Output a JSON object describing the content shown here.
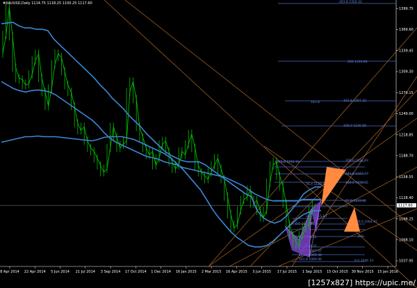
{
  "header": {
    "symbol_line": "#XAUUSD,Daily  1114.75 1118.25 1100.25 1117.60"
  },
  "watermark": "[1257x827] https://upic.me/",
  "colors": {
    "background": "#000000",
    "candle": "#00c000",
    "bands": "#3a8ad8",
    "fib_lines": "#4a6ac8",
    "trend_lines": "#b06a2a",
    "pattern_fill": "#7a3ec8",
    "arrow": "#ff8a40",
    "price_label_bg": "#ffffff"
  },
  "chart_data": {
    "type": "line",
    "title": "",
    "xlabel": "",
    "ylabel": "",
    "x_ticks": [
      "8 Apr 2014",
      "22 Apr 2014",
      "5 Jun 2014",
      "21 Jul 2014",
      "3 Sep 2014",
      "17 Oct 2014",
      "1 Dec 2014",
      "16 Jan 2015",
      "2 Mar 2015",
      "16 Apr 2015",
      "3 Jun 2015",
      "17 Jul 2015",
      "1 Sep 2015",
      "15 Oct 2015",
      "30 Nov 2015",
      "15 Jan 2016"
    ],
    "y_ticks": [
      1399.75,
      1369.6,
      1339.45,
      1309.3,
      1279.15,
      1249.0,
      1218.85,
      1188.7,
      1158.55,
      1128.4,
      1098.25,
      1068.1,
      1037.95
    ],
    "ylim": [
      1030,
      1410
    ],
    "current_price": "1117.60",
    "grid": false,
    "series": [
      {
        "values": [
          1335,
          1362,
          1402,
          1360,
          1315,
          1300,
          1298,
          1290,
          1292,
          1305,
          1325,
          1335,
          1300,
          1280,
          1260,
          1285,
          1320,
          1335,
          1330,
          1310,
          1290,
          1280,
          1260,
          1235,
          1225,
          1230,
          1210,
          1200,
          1195,
          1185,
          1175,
          1165,
          1170,
          1200,
          1230,
          1215,
          1200,
          1205,
          1210,
          1280,
          1295,
          1270,
          1230,
          1215,
          1200,
          1190,
          1195,
          1175,
          1185,
          1205,
          1210,
          1195,
          1180,
          1170,
          1175,
          1195,
          1190,
          1205,
          1220,
          1200,
          1175,
          1165,
          1160,
          1155,
          1165,
          1175,
          1185,
          1170,
          1155,
          1130,
          1105,
          1085,
          1090,
          1110,
          1125,
          1130,
          1140,
          1120,
          1125,
          1110,
          1100,
          1110,
          1150,
          1175,
          1180,
          1160,
          1145,
          1120,
          1090,
          1075,
          1065,
          1060,
          1075,
          1085,
          1090,
          1110,
          1120
        ]
      },
      {
        "values": [
          1378,
          1379,
          1380,
          1375,
          1372,
          1372,
          1370,
          1370,
          1368,
          1356,
          1348,
          1340,
          1332,
          1324,
          1316,
          1308,
          1300,
          1290,
          1282,
          1272,
          1264,
          1256,
          1246,
          1238,
          1230,
          1220,
          1212,
          1204,
          1196,
          1190,
          1186,
          1182,
          1180,
          1180,
          1180,
          1176,
          1170,
          1164,
          1158,
          1152,
          1146,
          1140,
          1134,
          1130,
          1110,
          1100,
          1095,
          1092,
          1095,
          1102,
          1112,
          1122,
          1134,
          1140,
          1144,
          1144
        ]
      },
      {
        "values": [
          1295,
          1290,
          1285,
          1282,
          1280,
          1282,
          1283,
          1282,
          1280,
          1276,
          1270,
          1264,
          1258,
          1252,
          1246,
          1240,
          1232,
          1222,
          1214,
          1208,
          1204,
          1200,
          1196,
          1192,
          1188,
          1186,
          1184,
          1180,
          1178,
          1176,
          1172,
          1170,
          1168,
          1166,
          1164,
          1162,
          1160,
          1158,
          1154,
          1150,
          1146,
          1140,
          1134,
          1130,
          1126,
          1124,
          1124,
          1124,
          1124,
          1124,
          1126,
          1126,
          1126,
          1126
        ]
      },
      {
        "values": [
          1208,
          1210,
          1212,
          1214,
          1216,
          1216,
          1217,
          1216,
          1216,
          1216,
          1215,
          1214,
          1213,
          1212,
          1211,
          1210,
          1212,
          1215,
          1216,
          1216,
          1216,
          1214,
          1212,
          1208,
          1204,
          1200,
          1196,
          1192,
          1186,
          1178,
          1170,
          1160,
          1150,
          1140,
          1126,
          1112,
          1100,
          1090,
          1080,
          1072,
          1066,
          1060,
          1058,
          1058,
          1060,
          1066,
          1074,
          1082,
          1090,
          1098,
          1104,
          1108,
          1110,
          1110
        ]
      }
    ],
    "fib_labels_upper": [
      "261.8 1354.22",
      "200 1319.80",
      "161.8 1267.32",
      "100.0 1236.69"
    ],
    "fib_labels_mid": [
      "161.8",
      "261.8 1192.93",
      "200.0 1192.93",
      "161.8 1167.19",
      "100.0 1155.45",
      "61.8 1133.66",
      "38.2 1115.14",
      "0.0 1094.26",
      "76.4 1128.98"
    ],
    "fib_labels_lower": [
      "50.0 1098.13",
      "61.8 1080.10",
      "100.0 1067.47",
      "127.2 1069.38",
      "161.8 1060.06",
      "100.0 1064.47",
      "0.0 1046.33"
    ],
    "fib_label_right_upper": "0.0"
  }
}
